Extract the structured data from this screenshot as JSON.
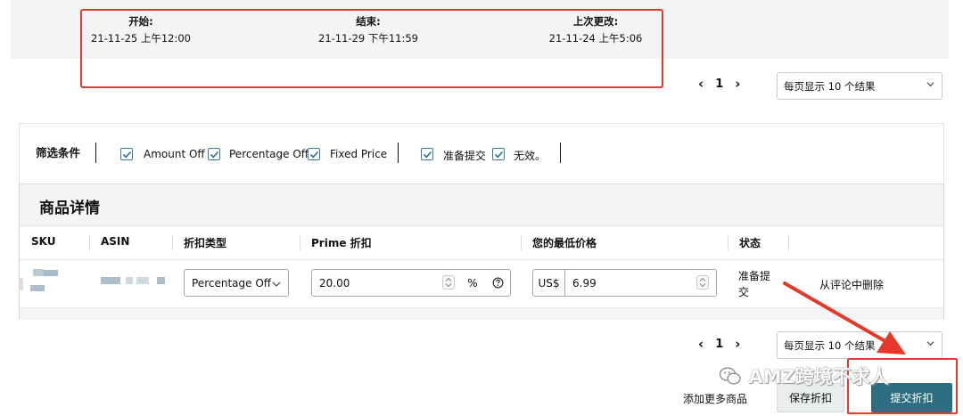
{
  "schedule": {
    "start_label": "开始:",
    "start_value": "21-11-25 上午12:00",
    "end_label": "结束:",
    "end_value": "21-11-29 下午11:59",
    "updated_label": "上次更改:",
    "updated_value": "21-11-24 上午5:06"
  },
  "pagination_top": {
    "prev": "‹",
    "page": "1",
    "next": "›",
    "per_page": "每页显示 10 个结果"
  },
  "filters": {
    "title": "筛选条件",
    "discount_types": [
      "Amount Off",
      "Percentage Off",
      "Fixed Price"
    ],
    "statuses": [
      "准备提交",
      "无效。"
    ],
    "all_checked": true
  },
  "detail": {
    "title": "商品详情",
    "columns": [
      "SKU",
      "ASIN",
      "折扣类型",
      "Prime 折扣",
      "您的最低价格",
      "状态"
    ],
    "row": {
      "discount_type": "Percentage Off",
      "prime_discount": "20.00",
      "percent_symbol": "%",
      "help_icon": "question-circle-icon",
      "currency": "US$",
      "min_price": "6.99",
      "status": "准备提交",
      "action": "从评论中删除"
    }
  },
  "pagination_bottom": {
    "prev": "‹",
    "page": "1",
    "next": "›",
    "per_page": "每页显示 10 个结果"
  },
  "actions": {
    "add_more": "添加更多商品",
    "save": "保存折扣",
    "submit": "提交折扣"
  },
  "watermark": "AMZ跨境不求人",
  "colors": {
    "highlight": "#e4392b",
    "primary": "#2e6e83",
    "checkbox": "#3a7a8e",
    "band": "#f2f4f5"
  }
}
